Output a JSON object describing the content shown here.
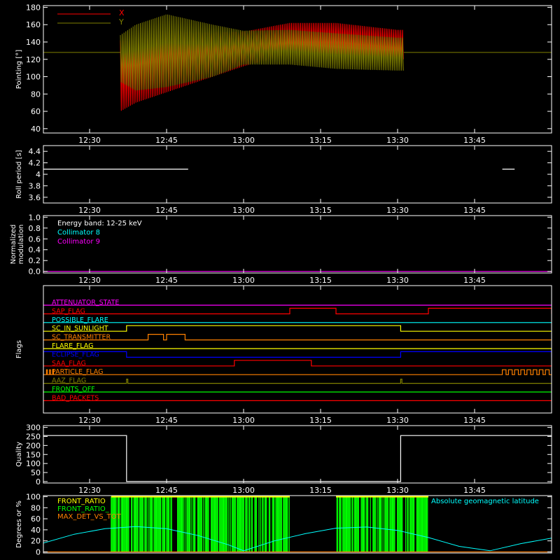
{
  "chart_data": [
    {
      "id": "pointing",
      "type": "line",
      "ylabel": "Pointing [°]",
      "yticks": [
        40,
        60,
        80,
        100,
        120,
        140,
        160,
        180
      ],
      "ylim": [
        35,
        182
      ],
      "xlim": [
        12.35,
        14.0
      ],
      "xtick_values": [
        12.5,
        12.75,
        13.0,
        13.25,
        13.5,
        13.75
      ],
      "xtick_labels": [
        "12:30",
        "12:45",
        "13:00",
        "13:15",
        "13:30",
        "13:45"
      ],
      "legend": [
        {
          "name": "X",
          "color": "#ff0000"
        },
        {
          "name": "Y",
          "color": "#808000"
        }
      ],
      "flat_value": 128,
      "window": [
        12.6,
        13.52
      ],
      "envelope": {
        "x": [
          12.6,
          12.65,
          12.75,
          12.9,
          13.0,
          13.15,
          13.3,
          13.5
        ],
        "y_max": [
          148,
          160,
          172,
          160,
          153,
          154,
          150,
          145
        ],
        "y_min": [
          94,
          84,
          88,
          100,
          114,
          114,
          109,
          107
        ],
        "x_max": [
          142,
          140,
          152,
          151,
          152,
          162,
          162,
          154
        ],
        "x_min": [
          60,
          70,
          82,
          100,
          112,
          126,
          126,
          120
        ]
      }
    },
    {
      "id": "roll-period",
      "type": "line",
      "ylabel": "Roll period [s]",
      "yticks": [
        3.6,
        3.8,
        4.0,
        4.2,
        4.4
      ],
      "ylim": [
        3.5,
        4.5
      ],
      "xlim": [
        12.35,
        14.0
      ],
      "xtick_values": [
        12.5,
        12.75,
        13.0,
        13.25,
        13.5,
        13.75
      ],
      "xtick_labels": [
        "12:30",
        "12:45",
        "13:00",
        "13:15",
        "13:30",
        "13:45"
      ],
      "segments": [
        {
          "x": [
            12.35,
            12.82
          ],
          "y": 4.09
        },
        {
          "x": [
            13.84,
            13.88
          ],
          "y": 4.09
        }
      ]
    },
    {
      "id": "modulation",
      "type": "line",
      "ylabel": "Normalized modulation",
      "ylabel_lines": [
        "Normalized",
        "modulation"
      ],
      "yticks": [
        0.0,
        0.2,
        0.4,
        0.6,
        0.8,
        1.0
      ],
      "ytick_labels": [
        "0.0",
        "0.2",
        "0.4",
        "0.6",
        "0.8",
        "1.0"
      ],
      "ylim": [
        -0.03,
        1.03
      ],
      "xlim": [
        12.35,
        14.0
      ],
      "xtick_values": [
        12.5,
        12.75,
        13.0,
        13.25,
        13.5,
        13.75
      ],
      "xtick_labels": [
        "12:30",
        "12:45",
        "13:00",
        "13:15",
        "13:30",
        "13:45"
      ],
      "annotations": [
        {
          "text": "Energy band: 12-25 keV",
          "color": "#ffffff"
        },
        {
          "text": "Collimator 8",
          "color": "#00ffff"
        },
        {
          "text": "Collimator 9",
          "color": "#ff00ff"
        }
      ],
      "series_value": 0.0
    },
    {
      "id": "flags",
      "type": "line",
      "ylabel": "Flags",
      "xlim": [
        12.35,
        14.0
      ],
      "xtick_values": [
        12.5,
        12.75,
        13.0,
        13.25,
        13.5,
        13.75
      ],
      "xtick_labels": [
        "12:30",
        "12:45",
        "13:00",
        "13:15",
        "13:30",
        "13:45"
      ],
      "flags": [
        {
          "name": "ATTENUATOR_STATE",
          "color": "#ff00ff",
          "changes": []
        },
        {
          "name": "SAP_FLAG",
          "color": "#ff0000",
          "changes": [
            [
              13.15,
              13.3
            ],
            [
              13.6,
              14.0
            ]
          ]
        },
        {
          "name": "POSSIBLE_FLARE",
          "color": "#00ffff",
          "changes": []
        },
        {
          "name": "SC_IN_SUNLIGHT",
          "color": "#ffff00",
          "changes": [
            [
              12.62,
              13.51
            ]
          ]
        },
        {
          "name": "SC_TRANSMITTER",
          "color": "#ff8000",
          "changes": [
            [
              12.69,
              12.74
            ],
            [
              12.75,
              12.81
            ]
          ]
        },
        {
          "name": "FLARE_FLAG",
          "color": "#ffff00",
          "changes": []
        },
        {
          "name": "ECLIPSE_FLAG",
          "color": "#0000ff",
          "changes": [
            [
              12.35,
              12.62
            ],
            [
              13.51,
              14.0
            ]
          ]
        },
        {
          "name": "SAA_FLAG",
          "color": "#ff0000",
          "changes": [
            [
              12.97,
              13.22
            ]
          ]
        },
        {
          "name": "PARTICLE_FLAG",
          "color": "#ff8000",
          "changes": []
        },
        {
          "name": "AAZ_FLAG",
          "color": "#808000",
          "changes": []
        },
        {
          "name": "FRONTS_OFF",
          "color": "#00ff00",
          "changes": []
        },
        {
          "name": "BAD_PACKETS",
          "color": "#ff0000",
          "changes": []
        }
      ]
    },
    {
      "id": "quality",
      "type": "line",
      "ylabel": "Quality",
      "yticks": [
        0,
        50,
        100,
        150,
        200,
        250,
        300
      ],
      "ylim": [
        -8,
        310
      ],
      "xlim": [
        12.35,
        14.0
      ],
      "xtick_values": [
        12.5,
        12.75,
        13.0,
        13.25,
        13.5,
        13.75
      ],
      "xtick_labels": [
        "12:30",
        "12:45",
        "13:00",
        "13:15",
        "13:30",
        "13:45"
      ],
      "x": [
        12.35,
        12.62,
        12.62,
        13.51,
        13.51,
        14.0
      ],
      "y": [
        255,
        255,
        0,
        0,
        255,
        255
      ]
    },
    {
      "id": "ratios",
      "type": "line",
      "ylabel": "Degrees or %",
      "yticks": [
        0,
        20,
        40,
        60,
        80,
        100
      ],
      "ylim": [
        -2,
        102
      ],
      "xlim": [
        12.35,
        14.0
      ],
      "legend": [
        {
          "name": "FRONT_RATIO",
          "color": "#ffff00"
        },
        {
          "name": "FRONT_RATIO_",
          "color": "#00ff00"
        },
        {
          "name": "MAX_DET_VS_TOT",
          "color": "#ff8000"
        }
      ],
      "annotation": {
        "text": "Absolute geomagnetic latitude",
        "color": "#00ffff"
      },
      "green_windows": [
        [
          12.57,
          13.15
        ],
        [
          13.3,
          13.6
        ]
      ],
      "latitude": {
        "x": [
          12.35,
          12.45,
          12.55,
          12.65,
          12.75,
          12.85,
          12.95,
          13.0,
          13.1,
          13.2,
          13.3,
          13.4,
          13.5,
          13.6,
          13.7,
          13.8,
          13.9,
          14.0
        ],
        "y": [
          16,
          32,
          42,
          46,
          42,
          30,
          13,
          2,
          20,
          33,
          43,
          45,
          39,
          26,
          10,
          2,
          15,
          25
        ]
      }
    }
  ]
}
